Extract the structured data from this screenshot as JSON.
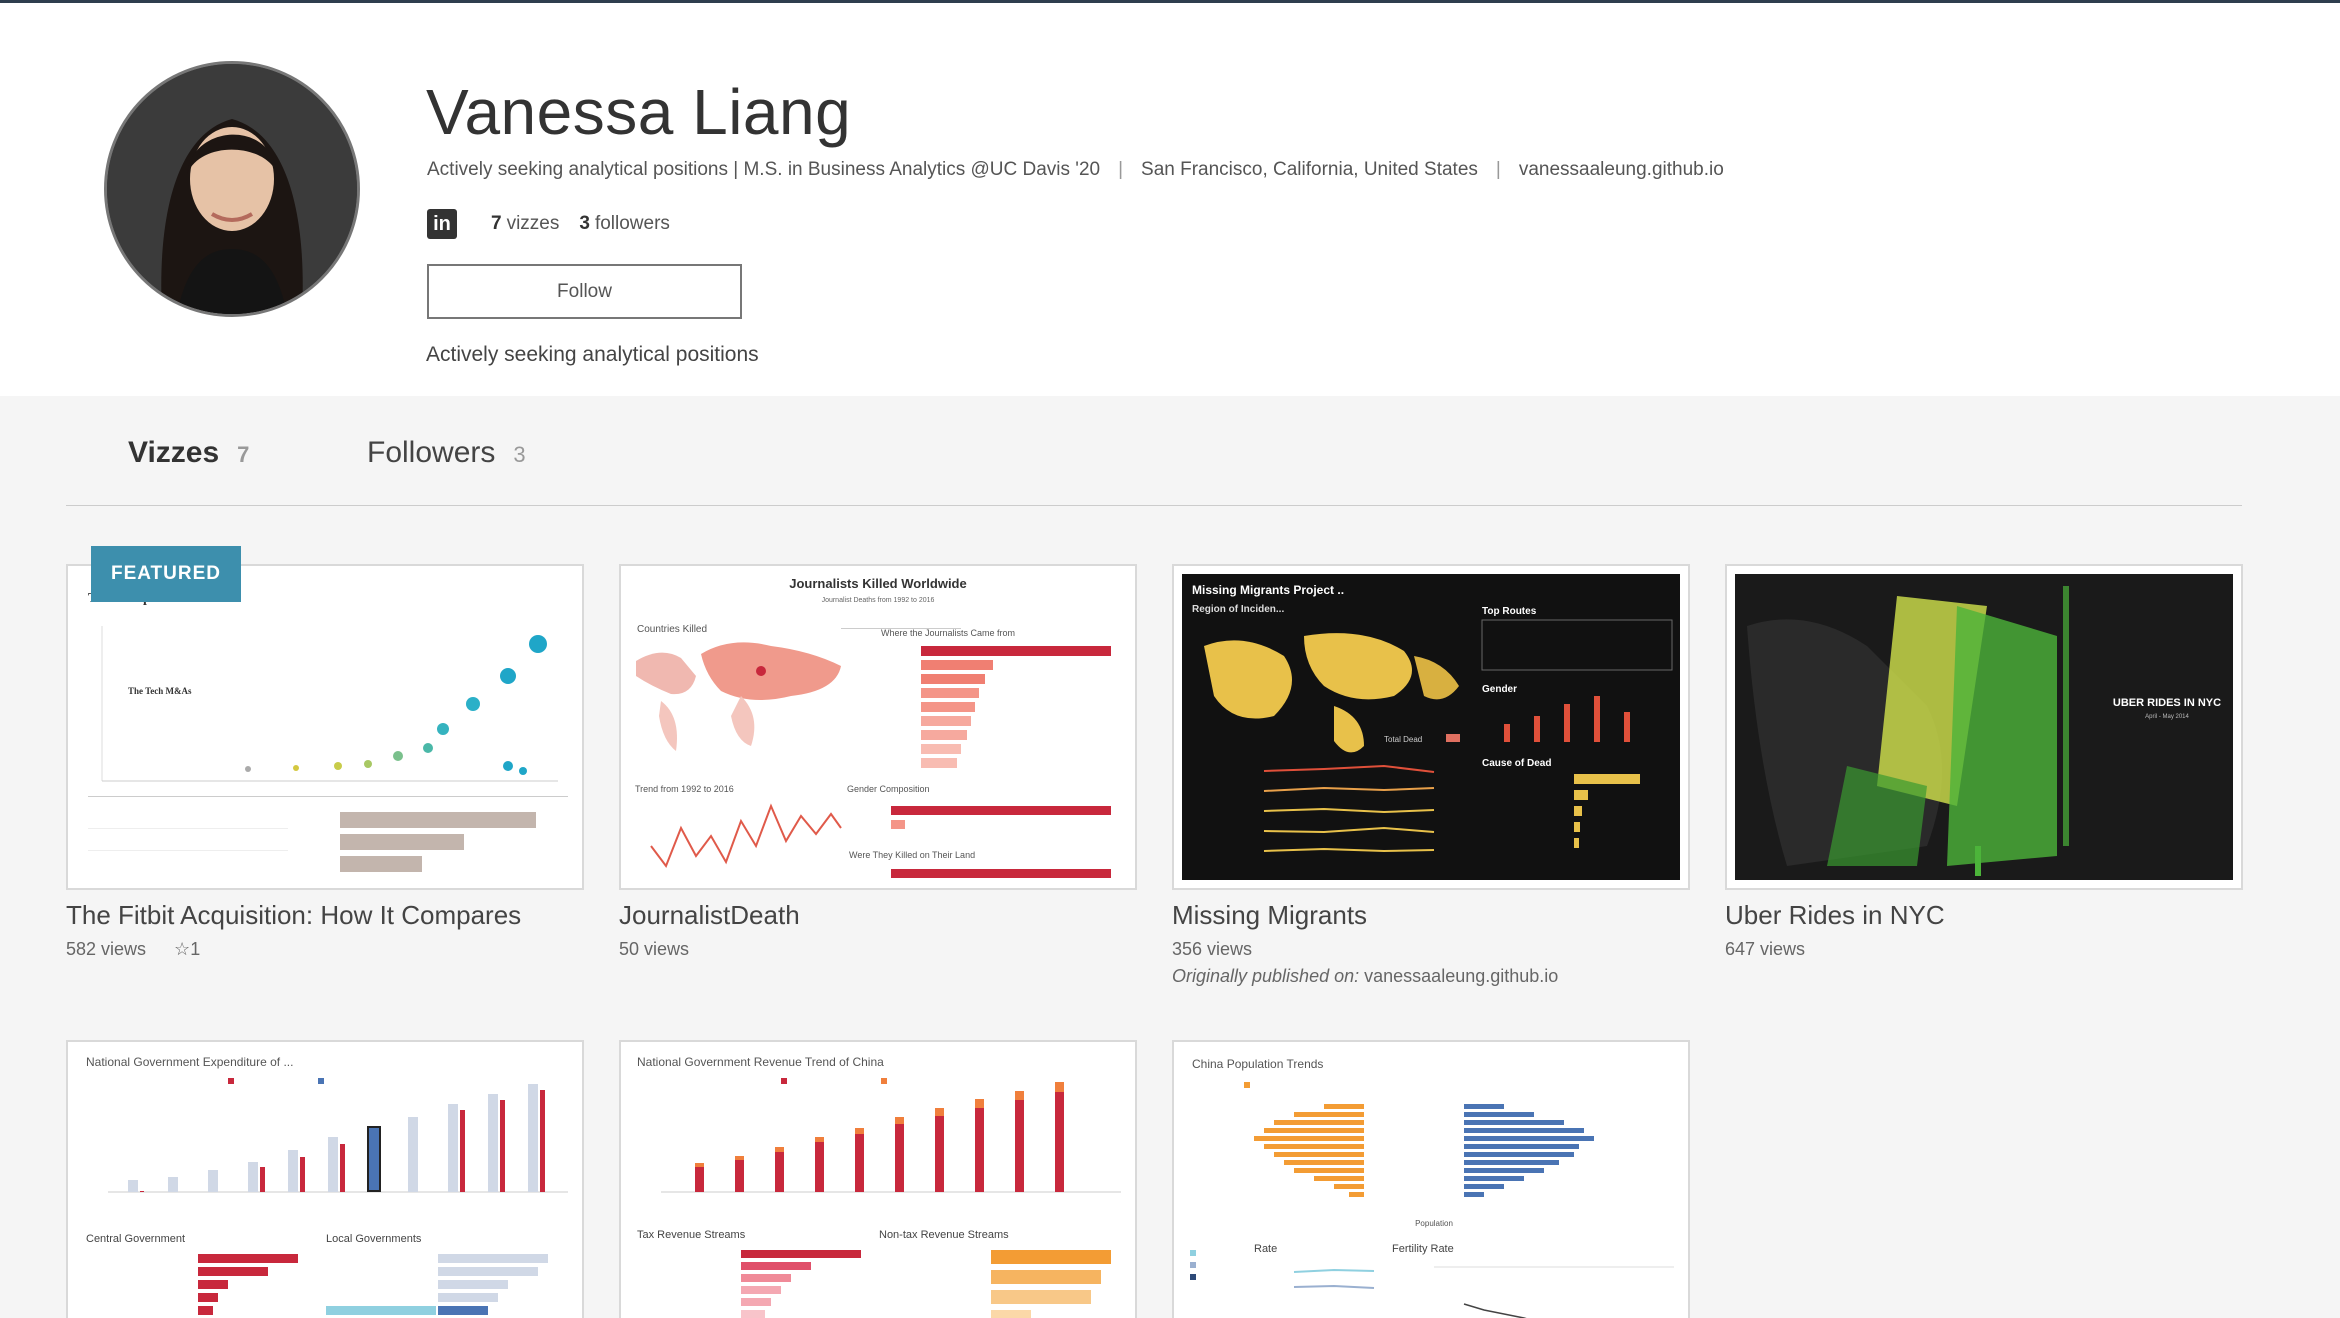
{
  "profile": {
    "name": "Vanessa Liang",
    "headline": "Actively seeking analytical positions | M.S. in Business Analytics @UC Davis '20",
    "location": "San Francisco, California, United States",
    "website": "vanessaaleung.github.io",
    "linkedin_glyph": "in",
    "vizzes_count": "7",
    "vizzes_label": "vizzes",
    "followers_count": "3",
    "followers_label": "followers",
    "follow_label": "Follow",
    "bio": "Actively seeking analytical positions"
  },
  "tabs": [
    {
      "label": "Vizzes",
      "count": "7"
    },
    {
      "label": "Followers",
      "count": "3"
    }
  ],
  "featured_label": "FEATURED",
  "vizzes": [
    {
      "title": "The Fitbit Acquisition: How It Compares",
      "views": "582 views",
      "favorites": "1",
      "thumb_title": "T   It Compares",
      "thumb_subtitle": "The Tech M&As"
    },
    {
      "title": "JournalistDeath",
      "views": "50 views",
      "thumb_title": "Journalists Killed Worldwide",
      "thumb_subtitle": "Journalist Deaths from 1992 to 2016",
      "thumb_label_1": "Countries Killed",
      "thumb_label_2": "Where the Journalists Came from",
      "thumb_label_3": "Trend from 1992 to 2016",
      "thumb_label_4": "Gender Composition",
      "thumb_label_5": "Were They Killed on Their Land"
    },
    {
      "title": "Missing Migrants",
      "views": "356 views",
      "origin_prefix": "Originally published on:",
      "origin_site": "vanessaaleung.github.io",
      "thumb_title": "Missing Migrants Project ..",
      "thumb_label_1": "Region of Inciden...",
      "thumb_label_2": "Top Routes",
      "thumb_label_3": "Gender",
      "thumb_label_4": "Cause of Dead",
      "thumb_label_5": "Total Dead"
    },
    {
      "title": "Uber Rides in NYC",
      "views": "647 views",
      "thumb_title": "UBER RIDES IN NYC",
      "thumb_subtitle": "April - May 2014"
    },
    {
      "thumb_title": "National Government Expenditure of ...",
      "thumb_label_1": "Central Government",
      "thumb_label_2": "Local Governments"
    },
    {
      "thumb_title": "National Government Revenue Trend of China",
      "thumb_label_1": "Tax Revenue Streams",
      "thumb_label_2": "Non-tax Revenue Streams"
    },
    {
      "thumb_title": "China Population Trends",
      "thumb_label_1": "Rate",
      "thumb_label_2": "Fertility Rate",
      "thumb_label_3": "Population"
    }
  ],
  "colors": {
    "featured": "#3d8fad",
    "accent_red": "#c8283c",
    "accent_orange": "#f39c34",
    "accent_blue": "#4a74b4",
    "uber_green": "#5ec43c"
  }
}
